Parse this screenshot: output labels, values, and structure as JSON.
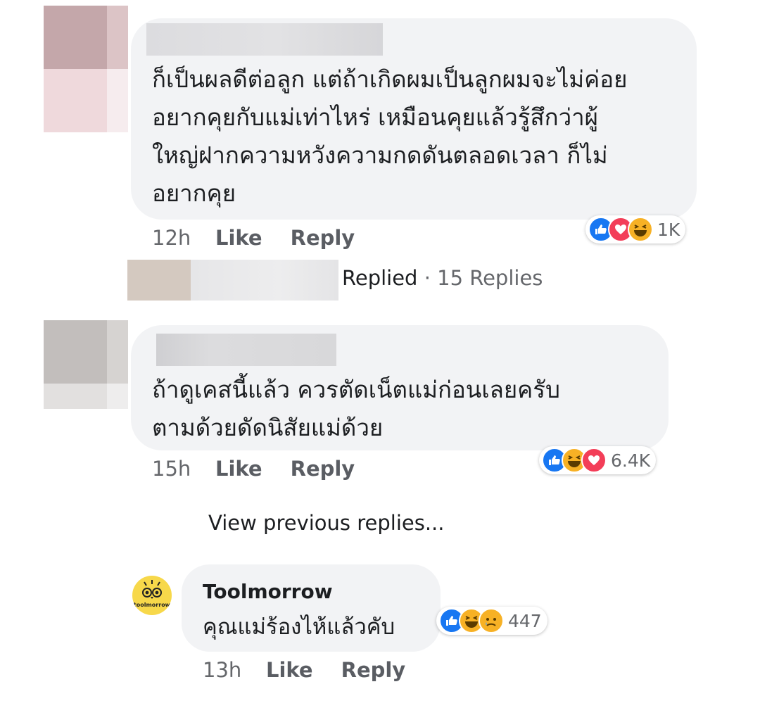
{
  "comments": [
    {
      "text": "ก็เป็นผลดีต่อลูก แต่ถ้าเกิดผมเป็นลูกผมจะไม่ค่อย\nอยากคุยกับแม่เท่าไหร่ เหมือนคุยแล้วรู้สึกว่าผู้\nใหญ่ฝากความหวังความกดดันตลอดเวลา ก็ไม่\nอยากคุย",
      "time": "12h",
      "like_label": "Like",
      "reply_label": "Reply",
      "reactions": [
        "like",
        "love",
        "haha"
      ],
      "reaction_count": "1K"
    },
    {
      "text": "ถ้าดูเคสนี้แล้ว ควรตัดเน็ตแม่ก่อนเลยครับ\nตามด้วยดัดนิสัยแม่ด้วย",
      "time": "15h",
      "like_label": "Like",
      "reply_label": "Reply",
      "reactions": [
        "like",
        "haha",
        "love"
      ],
      "reaction_count": "6.4K"
    }
  ],
  "replied_summary": {
    "label": "Replied",
    "separator": "·",
    "count_text": "15 Replies"
  },
  "view_previous": "View previous replies...",
  "reply": {
    "author": "Toolmorrow",
    "avatar_text": "toolmorrow",
    "text": "คุณแม่ร้องไห้แล้วคับ",
    "time": "13h",
    "like_label": "Like",
    "reply_label": "Reply",
    "reactions": [
      "like",
      "haha",
      "sad"
    ],
    "reaction_count": "447"
  },
  "colors": {
    "like": "#1877f2",
    "love": "#f33e58",
    "haha": "#f7b125",
    "bubble": "#f2f3f5",
    "avatar_yellow": "#f7d84a"
  }
}
